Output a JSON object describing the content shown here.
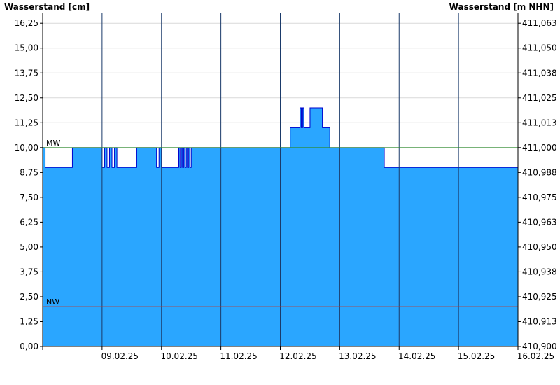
{
  "chart_data": {
    "type": "area",
    "left_axis_title": "Wasserstand [cm]",
    "right_axis_title": "Wasserstand [m NHN]",
    "x_range": [
      "08.02.25 00:00",
      "16.02.25 00:00"
    ],
    "y_range": [
      0,
      16.25
    ],
    "y_ticks": [
      0,
      1.25,
      2.5,
      3.75,
      5,
      6.25,
      7.5,
      8.75,
      10,
      11.25,
      12.5,
      13.75,
      15,
      16.25
    ],
    "y_tick_labels": [
      "0,00",
      "1,25",
      "2,50",
      "3,75",
      "5,00",
      "6,25",
      "7,50",
      "8,75",
      "10,00",
      "11,25",
      "12,50",
      "13,75",
      "15,00",
      "16,25"
    ],
    "y_right_tick_labels": [
      "410,900",
      "410,913",
      "410,925",
      "410,938",
      "410,950",
      "410,963",
      "410,975",
      "410,988",
      "411,000",
      "411,013",
      "411,025",
      "411,038",
      "411,050",
      "411,063"
    ],
    "x_day_ticks": [
      "09.02.25",
      "10.02.25",
      "11.02.25",
      "12.02.25",
      "13.02.25",
      "14.02.25",
      "15.02.25",
      "16.02.25"
    ],
    "x_tick_labels": [
      "09.02.25",
      "10.02.25",
      "11.02.25",
      "12.02.25",
      "13.02.25",
      "14.02.25",
      "15.02.25",
      "16.02.25"
    ],
    "grid": true,
    "reference_lines": [
      {
        "label": "MW",
        "value": 10,
        "color": "#2e8b2e"
      },
      {
        "label": "NW",
        "value": 2,
        "color": "#c0392b"
      }
    ],
    "series": [
      {
        "values": [
          [
            "08.02.25 00:00",
            10
          ],
          [
            "08.02.25 01:00",
            10
          ],
          [
            "08.02.25 01:00",
            9
          ],
          [
            "08.02.25 12:00",
            9
          ],
          [
            "08.02.25 12:00",
            10
          ],
          [
            "09.02.25 00:00",
            10
          ],
          [
            "09.02.25 00:00",
            9
          ],
          [
            "09.02.25 01:00",
            9
          ],
          [
            "09.02.25 01:00",
            10
          ],
          [
            "09.02.25 02:00",
            10
          ],
          [
            "09.02.25 02:00",
            9
          ],
          [
            "09.02.25 03:00",
            9
          ],
          [
            "09.02.25 03:00",
            10
          ],
          [
            "09.02.25 04:00",
            10
          ],
          [
            "09.02.25 04:00",
            9
          ],
          [
            "09.02.25 05:00",
            9
          ],
          [
            "09.02.25 05:00",
            10
          ],
          [
            "09.02.25 06:00",
            10
          ],
          [
            "09.02.25 06:00",
            9
          ],
          [
            "09.02.25 14:00",
            9
          ],
          [
            "09.02.25 14:00",
            10
          ],
          [
            "09.02.25 22:00",
            10
          ],
          [
            "09.02.25 22:00",
            9
          ],
          [
            "09.02.25 23:00",
            9
          ],
          [
            "09.02.25 23:00",
            10
          ],
          [
            "10.02.25 00:00",
            10
          ],
          [
            "10.02.25 00:00",
            9
          ],
          [
            "10.02.25 07:00",
            9
          ],
          [
            "10.02.25 07:00",
            10
          ],
          [
            "10.02.25 07:30",
            10
          ],
          [
            "10.02.25 07:30",
            9
          ],
          [
            "10.02.25 08:00",
            9
          ],
          [
            "10.02.25 08:00",
            10
          ],
          [
            "10.02.25 08:30",
            10
          ],
          [
            "10.02.25 08:30",
            9
          ],
          [
            "10.02.25 09:00",
            9
          ],
          [
            "10.02.25 09:00",
            10
          ],
          [
            "10.02.25 09:30",
            10
          ],
          [
            "10.02.25 09:30",
            9
          ],
          [
            "10.02.25 10:00",
            9
          ],
          [
            "10.02.25 10:00",
            10
          ],
          [
            "10.02.25 10:30",
            10
          ],
          [
            "10.02.25 10:30",
            9
          ],
          [
            "10.02.25 11:00",
            9
          ],
          [
            "10.02.25 11:00",
            10
          ],
          [
            "10.02.25 11:30",
            10
          ],
          [
            "10.02.25 11:30",
            9
          ],
          [
            "10.02.25 12:00",
            9
          ],
          [
            "10.02.25 12:00",
            10
          ],
          [
            "12.02.25 04:00",
            10
          ],
          [
            "12.02.25 04:00",
            11
          ],
          [
            "12.02.25 08:00",
            11
          ],
          [
            "12.02.25 08:00",
            12
          ],
          [
            "12.02.25 08:30",
            12
          ],
          [
            "12.02.25 08:30",
            11
          ],
          [
            "12.02.25 09:00",
            11
          ],
          [
            "12.02.25 09:00",
            12
          ],
          [
            "12.02.25 09:30",
            12
          ],
          [
            "12.02.25 09:30",
            11
          ],
          [
            "12.02.25 12:00",
            11
          ],
          [
            "12.02.25 12:00",
            12
          ],
          [
            "12.02.25 17:00",
            12
          ],
          [
            "12.02.25 17:00",
            11
          ],
          [
            "12.02.25 20:00",
            11
          ],
          [
            "12.02.25 20:00",
            10
          ],
          [
            "13.02.25 18:00",
            10
          ],
          [
            "13.02.25 18:00",
            9
          ],
          [
            "15.02.25 23:59",
            9
          ]
        ]
      }
    ]
  }
}
